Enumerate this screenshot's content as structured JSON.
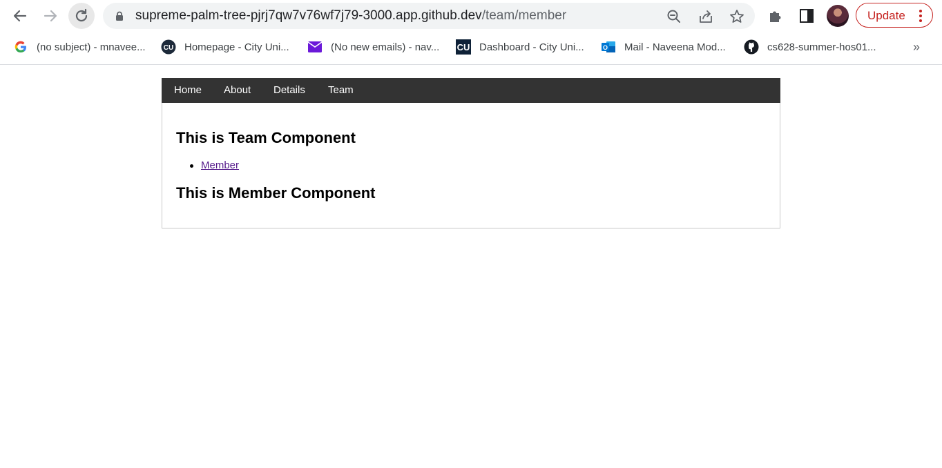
{
  "browser": {
    "url_host": "supreme-palm-tree-pjrj7qw7v76wf7j79-3000.app.github.dev",
    "url_path": "/team/member",
    "update_label": "Update",
    "accent_color": "#c5221f"
  },
  "bookmarks": [
    {
      "label": "(no subject) - mnavee...",
      "icon": "google-icon"
    },
    {
      "label": "Homepage - City Uni...",
      "icon": "cu-circle-icon"
    },
    {
      "label": "(No new emails) - nav...",
      "icon": "mail-icon"
    },
    {
      "label": "Dashboard - City Uni...",
      "icon": "cu-square-icon"
    },
    {
      "label": "Mail - Naveena Mod...",
      "icon": "outlook-icon"
    },
    {
      "label": "cs628-summer-hos01...",
      "icon": "github-icon"
    }
  ],
  "nav": {
    "items": [
      "Home",
      "About",
      "Details",
      "Team"
    ],
    "background": "#333333"
  },
  "page": {
    "team_heading": "This is Team Component",
    "member_link": "Member",
    "member_heading": "This is Member Component"
  }
}
